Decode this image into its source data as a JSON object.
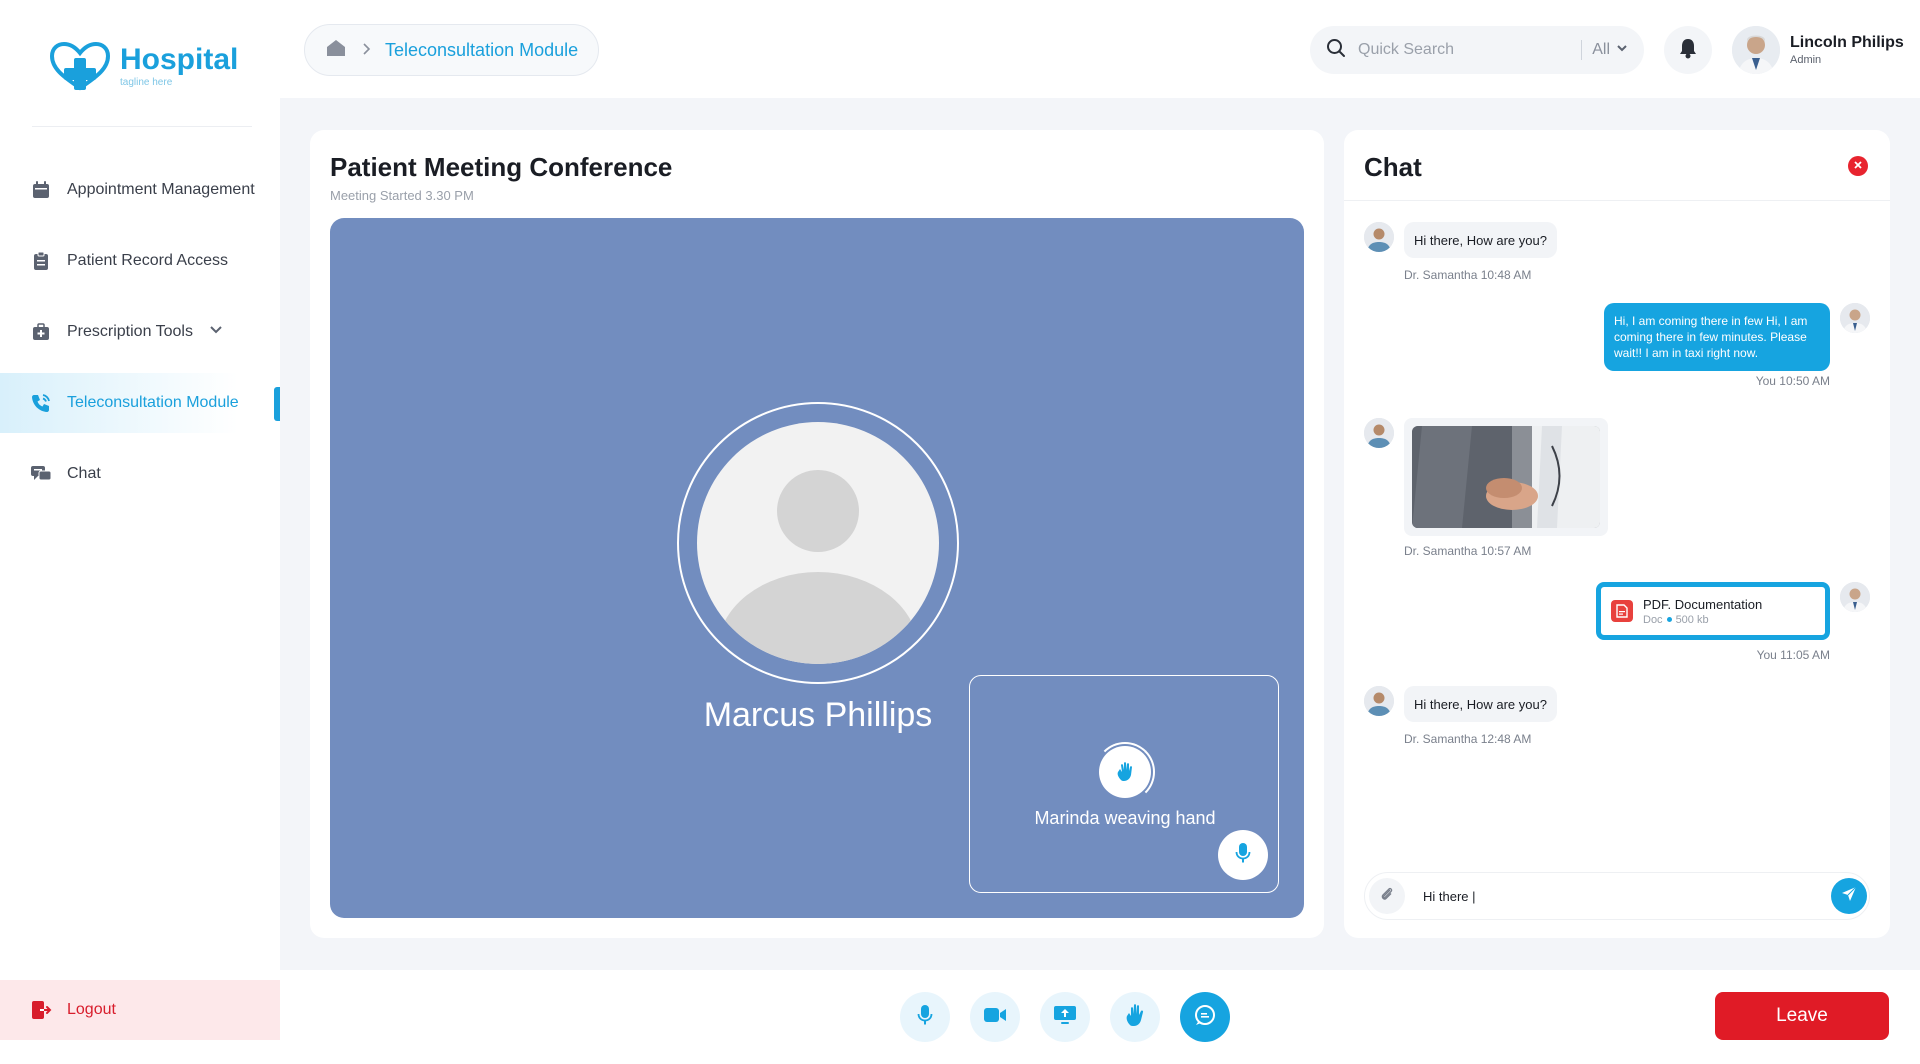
{
  "brand": {
    "name": "Hospital",
    "tagline": "tagline here"
  },
  "sidebar": {
    "items": [
      {
        "label": "Appointment Management",
        "icon": "calendar-icon"
      },
      {
        "label": "Patient Record Access",
        "icon": "clipboard-icon"
      },
      {
        "label": "Prescription Tools",
        "icon": "medical-kit-icon",
        "has_dropdown": true
      },
      {
        "label": "Teleconsultation Module",
        "icon": "phone-icon",
        "active": true
      },
      {
        "label": "Chat",
        "icon": "chat-bubbles-icon"
      }
    ],
    "logout_label": "Logout"
  },
  "header": {
    "breadcrumb": {
      "current": "Teleconsultation Module"
    },
    "search": {
      "placeholder": "Quick Search",
      "filter": "All"
    },
    "user": {
      "name": "Lincoln Philips",
      "role": "Admin"
    }
  },
  "meeting": {
    "title": "Patient Meeting Conference",
    "subtitle": "Meeting Started 3.30 PM",
    "main_participant": "Marcus Phillips",
    "pip_label": "Marinda weaving hand"
  },
  "chat": {
    "title": "Chat",
    "messages": [
      {
        "from": "other",
        "text": "Hi there, How are you?",
        "meta": "Dr. Samantha 10:48 AM"
      },
      {
        "from": "self",
        "text": "Hi, I am coming there in few Hi, I am coming there in few minutes. Please wait!! I am in taxi right now.",
        "meta": "You 10:50 AM"
      },
      {
        "from": "other",
        "type": "image",
        "meta": "Dr. Samantha 10:57 AM"
      },
      {
        "from": "self",
        "type": "file",
        "file_name": "PDF. Documentation",
        "file_type": "Doc",
        "file_size": "500 kb",
        "meta": "You 11:05 AM"
      },
      {
        "from": "other",
        "text": "Hi there, How are you?",
        "meta": "Dr. Samantha 12:48 AM"
      }
    ],
    "composer_value": "Hi there |"
  },
  "controls": {
    "buttons": [
      "microphone-icon",
      "video-camera-icon",
      "screen-share-icon",
      "raise-hand-icon",
      "chat-icon"
    ],
    "leave_label": "Leave"
  },
  "colors": {
    "accent": "#1aa0dc",
    "danger": "#e01b26",
    "stage": "#728dbf"
  }
}
